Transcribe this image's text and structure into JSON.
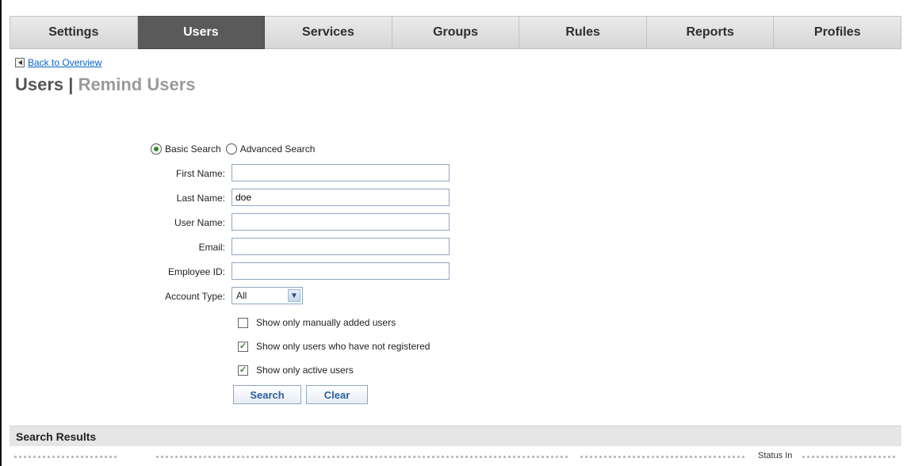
{
  "tabs": [
    {
      "label": "Settings",
      "active": false
    },
    {
      "label": "Users",
      "active": true
    },
    {
      "label": "Services",
      "active": false
    },
    {
      "label": "Groups",
      "active": false
    },
    {
      "label": "Rules",
      "active": false
    },
    {
      "label": "Reports",
      "active": false
    },
    {
      "label": "Profiles",
      "active": false
    }
  ],
  "back_link": {
    "label": "Back to Overview",
    "icon": "back-arrow-icon"
  },
  "title": {
    "main": "Users",
    "separator": "|",
    "sub": "Remind Users"
  },
  "search_mode": {
    "basic_label": "Basic Search",
    "advanced_label": "Advanced Search",
    "selected": "Basic Search"
  },
  "fields": {
    "first_name": {
      "label": "First Name:",
      "value": ""
    },
    "last_name": {
      "label": "Last Name:",
      "value": "doe"
    },
    "user_name": {
      "label": "User Name:",
      "value": ""
    },
    "email": {
      "label": "Email:",
      "value": ""
    },
    "employee_id": {
      "label": "Employee ID:",
      "value": ""
    },
    "account_type": {
      "label": "Account Type:",
      "value": "All"
    }
  },
  "options": {
    "manual": {
      "label": "Show only manually added users",
      "checked": false
    },
    "not_registered": {
      "label": "Show only users who have not registered",
      "checked": true
    },
    "active": {
      "label": "Show only active users",
      "checked": true
    }
  },
  "buttons": {
    "search": "Search",
    "clear": "Clear"
  },
  "results": {
    "title": "Search Results",
    "partial_column": "Status In"
  },
  "colors": {
    "active_tab": "#5a5a5a",
    "link": "#0a64c8",
    "button_text": "#2b5fa3",
    "check": "#2b8a2b"
  }
}
